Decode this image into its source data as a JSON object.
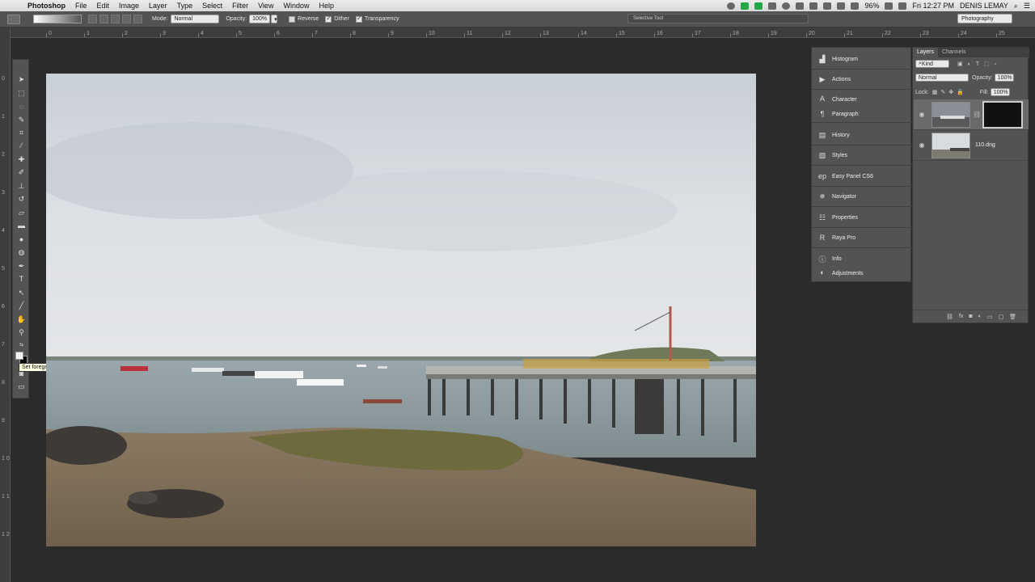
{
  "menubar": {
    "app": "Photoshop",
    "items": [
      "File",
      "Edit",
      "Image",
      "Layer",
      "Type",
      "Select",
      "Filter",
      "View",
      "Window",
      "Help"
    ],
    "battery": "96%",
    "clock": "Fri 12:27 PM",
    "user": "DENIS LEMAY"
  },
  "options": {
    "mode_label": "Mode:",
    "mode_value": "Normal",
    "opacity_label": "Opacity:",
    "opacity_value": "100%",
    "reverse": "Reverse",
    "dither": "Dither",
    "transparency": "Transparency",
    "tool_tip_box": "Selective Tool",
    "workspace": "Photography"
  },
  "ruler_h": [
    "0",
    "1",
    "2",
    "3",
    "4",
    "5",
    "6",
    "7",
    "8",
    "9",
    "10",
    "11",
    "12",
    "13",
    "14",
    "15",
    "16",
    "17",
    "18",
    "19",
    "20",
    "21",
    "22",
    "23",
    "24",
    "25"
  ],
  "ruler_v": [
    "0",
    "1",
    "2",
    "3",
    "4",
    "5",
    "6",
    "7",
    "8",
    "9",
    "1 0",
    "1 1",
    "1 2"
  ],
  "tooltip": "Set foreground color",
  "panels": [
    {
      "label": "Histogram",
      "icon": "histogram-icon"
    },
    {
      "label": "Actions",
      "icon": "play-icon"
    },
    {
      "label": "Character",
      "icon": "character-icon"
    },
    {
      "label": "Paragraph",
      "icon": "paragraph-icon"
    },
    {
      "label": "History",
      "icon": "history-icon"
    },
    {
      "label": "Styles",
      "icon": "styles-icon"
    },
    {
      "label": "Easy Panel CS6",
      "icon": "ep-icon"
    },
    {
      "label": "Navigator",
      "icon": "navigator-icon"
    },
    {
      "label": "Properties",
      "icon": "properties-icon"
    },
    {
      "label": "Raya Pro",
      "icon": "raya-icon"
    },
    {
      "label": "Info",
      "icon": "info-icon"
    },
    {
      "label": "Adjustments",
      "icon": "adjustments-icon"
    }
  ],
  "layers": {
    "tabs": [
      "Layers",
      "Channels"
    ],
    "kind": "Kind",
    "blend": "Normal",
    "opacity_label": "Opacity:",
    "opacity_value": "100%",
    "lock_label": "Lock:",
    "fill_label": "Fill:",
    "fill_value": "100%",
    "items": [
      {
        "name": "",
        "has_mask": true
      },
      {
        "name": "110.dng",
        "has_mask": false
      }
    ]
  }
}
